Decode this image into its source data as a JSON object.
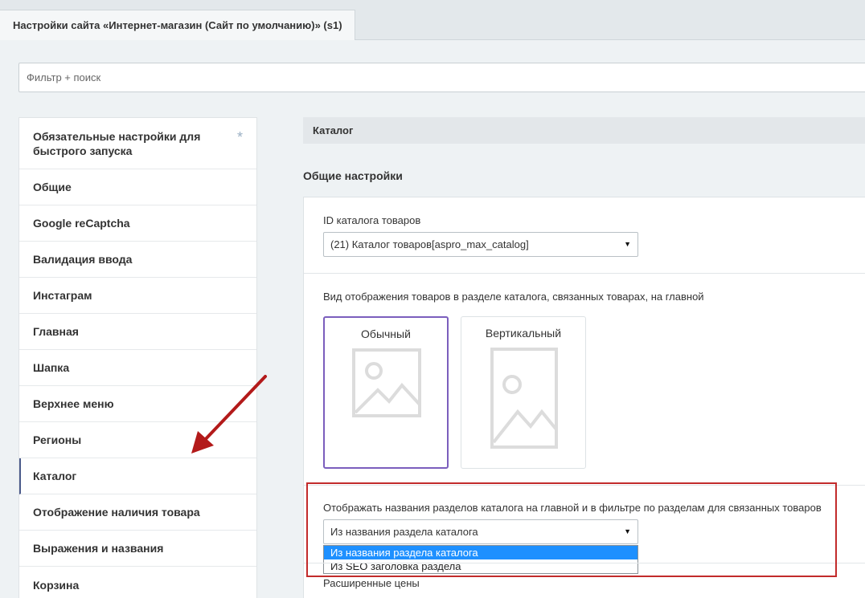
{
  "tab": {
    "title": "Настройки сайта «Интернет-магазин (Сайт по умолчанию)» (s1)"
  },
  "filter": {
    "placeholder": "Фильтр + поиск"
  },
  "sidebar": {
    "items": [
      {
        "label": "Обязательные настройки для быстрого запуска",
        "star": "*"
      },
      {
        "label": "Общие"
      },
      {
        "label": "Google reCaptcha"
      },
      {
        "label": "Валидация ввода"
      },
      {
        "label": "Инстаграм"
      },
      {
        "label": "Главная"
      },
      {
        "label": "Шапка"
      },
      {
        "label": "Верхнее меню"
      },
      {
        "label": "Регионы"
      },
      {
        "label": "Каталог"
      },
      {
        "label": "Отображение наличия товара"
      },
      {
        "label": "Выражения и названия"
      },
      {
        "label": "Корзина"
      }
    ],
    "active_index": 9
  },
  "main": {
    "section_title": "Каталог",
    "subsection_title": "Общие настройки",
    "catalog_id": {
      "label": "ID каталога товаров",
      "value": "(21) Каталог товаров[aspro_max_catalog]"
    },
    "view_mode": {
      "label": "Вид отображения товаров в разделе каталога, связанных товарах, на главной",
      "options": [
        {
          "label": "Обычный",
          "selected": true
        },
        {
          "label": "Вертикальный",
          "selected": false
        }
      ]
    },
    "section_names": {
      "label": "Отображать названия разделов каталога на главной и в фильтре по разделам для связанных товаров",
      "value": "Из названия раздела каталога",
      "options": [
        "Из названия раздела каталога",
        "Из SEO заголовка раздела"
      ]
    },
    "extended_prices": {
      "label": "Расширенные цены"
    }
  },
  "colors": {
    "accent_selected": "#7b5ebd",
    "highlight_red": "#c22b2b",
    "arrow_red": "#b31a1a",
    "option_highlight": "#1e90ff"
  }
}
